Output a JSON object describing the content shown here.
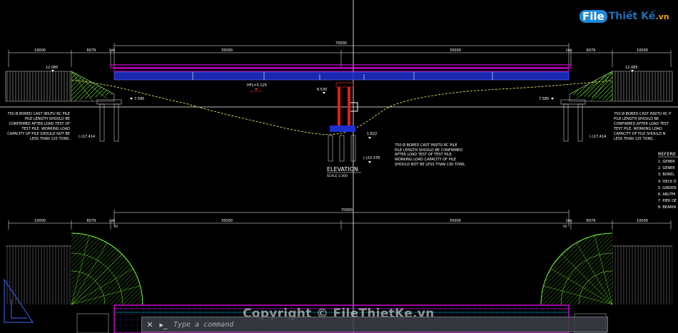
{
  "brand": {
    "part1": "File",
    "part2": "Thiết Kế",
    "part3": ".vn"
  },
  "watermark": "Copyright © FileThietKe.vn",
  "command_line": {
    "placeholder": "Type a command"
  },
  "icons": {
    "close": "close-icon",
    "recent": "recent-commands-icon",
    "ucs": "ucs-icon"
  },
  "colors": {
    "background": "#000000",
    "deck": "#ff00ff",
    "girder": "#1e2fd0",
    "pier": "#e01e1e",
    "approach": "#7cff3a",
    "ground": "#ffff66",
    "dims": "#ffffff"
  },
  "elevation": {
    "overall_dim": "70000",
    "dims": [
      "10000",
      "6079",
      "200",
      "35000",
      "35000",
      "200",
      "6079",
      "10000"
    ],
    "levels": {
      "left_top": "12.085",
      "right_top": "12.085",
      "hfl": "HFL=5.125",
      "left_ground": "7.585",
      "right_ground": "7.585",
      "pier_ground": "6.530",
      "pier_bottom": "1.822",
      "pile_bottom_center": "(-)23.378",
      "pile_bottom_left": "(-)17.414",
      "pile_bottom_right": "(-)17.414"
    },
    "title": "ELEVATION",
    "scale": "SCALE 1:300",
    "note_left": [
      "750 Ø BORED CAST INSITU RC PILE",
      "PILE LENGTH SHOULD BE",
      "CONFIRMED  AFTER LOAD TEST OF",
      "TEST PILE.  WORKING LOAD",
      "CAPACITY OF PILE  SHOULD NOT BE",
      "LESS THAN 125 TONS."
    ],
    "note_center": [
      "750 Ø BORED CAST INSITU RC PILE",
      "PILE LENGTH SHOULD BE CONFIRMED",
      "AFTER LOAD TEST OF TEST PILE.",
      "WORKING LOAD CAPACITY OF PILE",
      "SHOULD NOT BE LESS THAN 130 TONS."
    ],
    "note_right": [
      "750 Ø BORED CAST INSITU RC P",
      "PILE LENGTH SHOULD BE",
      "CONFIRMED  AFTER LOAD TEST",
      "TEST PILE.  WORKING LOAD",
      "CAPACITY OF PILE  SHOULD N",
      "LESS THAN 125 TONS."
    ]
  },
  "references": {
    "title": "REFERE",
    "items": [
      "1. GENER",
      "2. GENER",
      "3. BOREL",
      "4. DECK D",
      "5. GIRDER",
      "6. ABUTM",
      "7. PIER DE",
      "8. BEARIN"
    ]
  },
  "plan": {
    "overall_dim": "70000",
    "dims": [
      "10000",
      "6079",
      "200",
      "35000",
      "35000",
      "200",
      "6079",
      "10000"
    ],
    "sub_dims": [
      "50",
      "50"
    ]
  }
}
